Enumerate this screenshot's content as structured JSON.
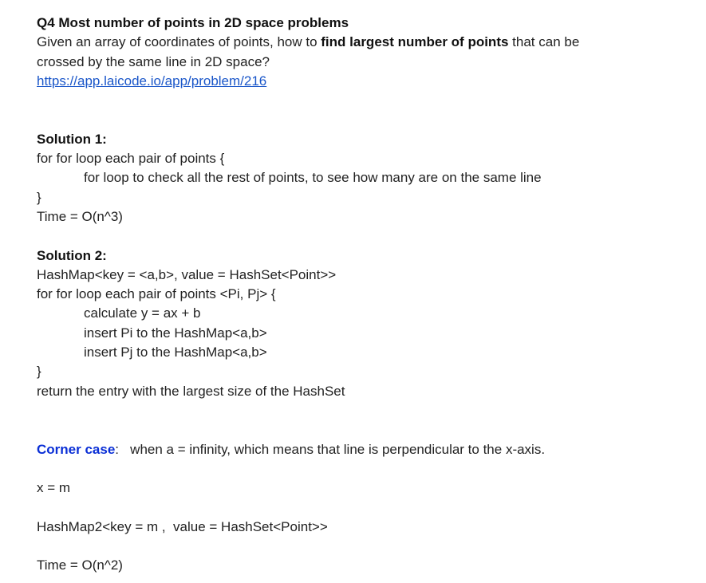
{
  "title": "Q4 Most number of points in 2D space problems",
  "intro": {
    "part1": "Given an array of coordinates of points, how to ",
    "bold": "find largest number of points",
    "part2": " that can be",
    "line2": "crossed by the same line in 2D space?"
  },
  "link": "https://app.laicode.io/app/problem/216",
  "solution1": {
    "heading": "Solution 1:",
    "lines": [
      "for for loop each pair of points {",
      "for loop to check all the rest of points, to see how many are on the same line",
      "}",
      "Time = O(n^3)"
    ]
  },
  "solution2": {
    "heading": "Solution 2:",
    "lines": [
      "HashMap<key = <a,b>, value = HashSet<Point>>",
      "for for loop each pair of points <Pi, Pj> {",
      "calculate y = ax + b",
      "insert Pi to the HashMap<a,b>",
      "insert Pj to the HashMap<a,b>",
      "}",
      "return the entry with the largest size of the HashSet"
    ]
  },
  "corner_case": {
    "label": "Corner case",
    "colon": ":",
    "text": "   when a = infinity, which means that line is perpendicular to the x-axis.",
    "line_x": "x = m",
    "hashmap2": "HashMap2<key = m ,  value = HashSet<Point>>",
    "time": "Time = O(n^2)"
  },
  "colors": {
    "text": "#222222",
    "link": "#1a56c9",
    "corner_label": "#0a2fd6"
  }
}
